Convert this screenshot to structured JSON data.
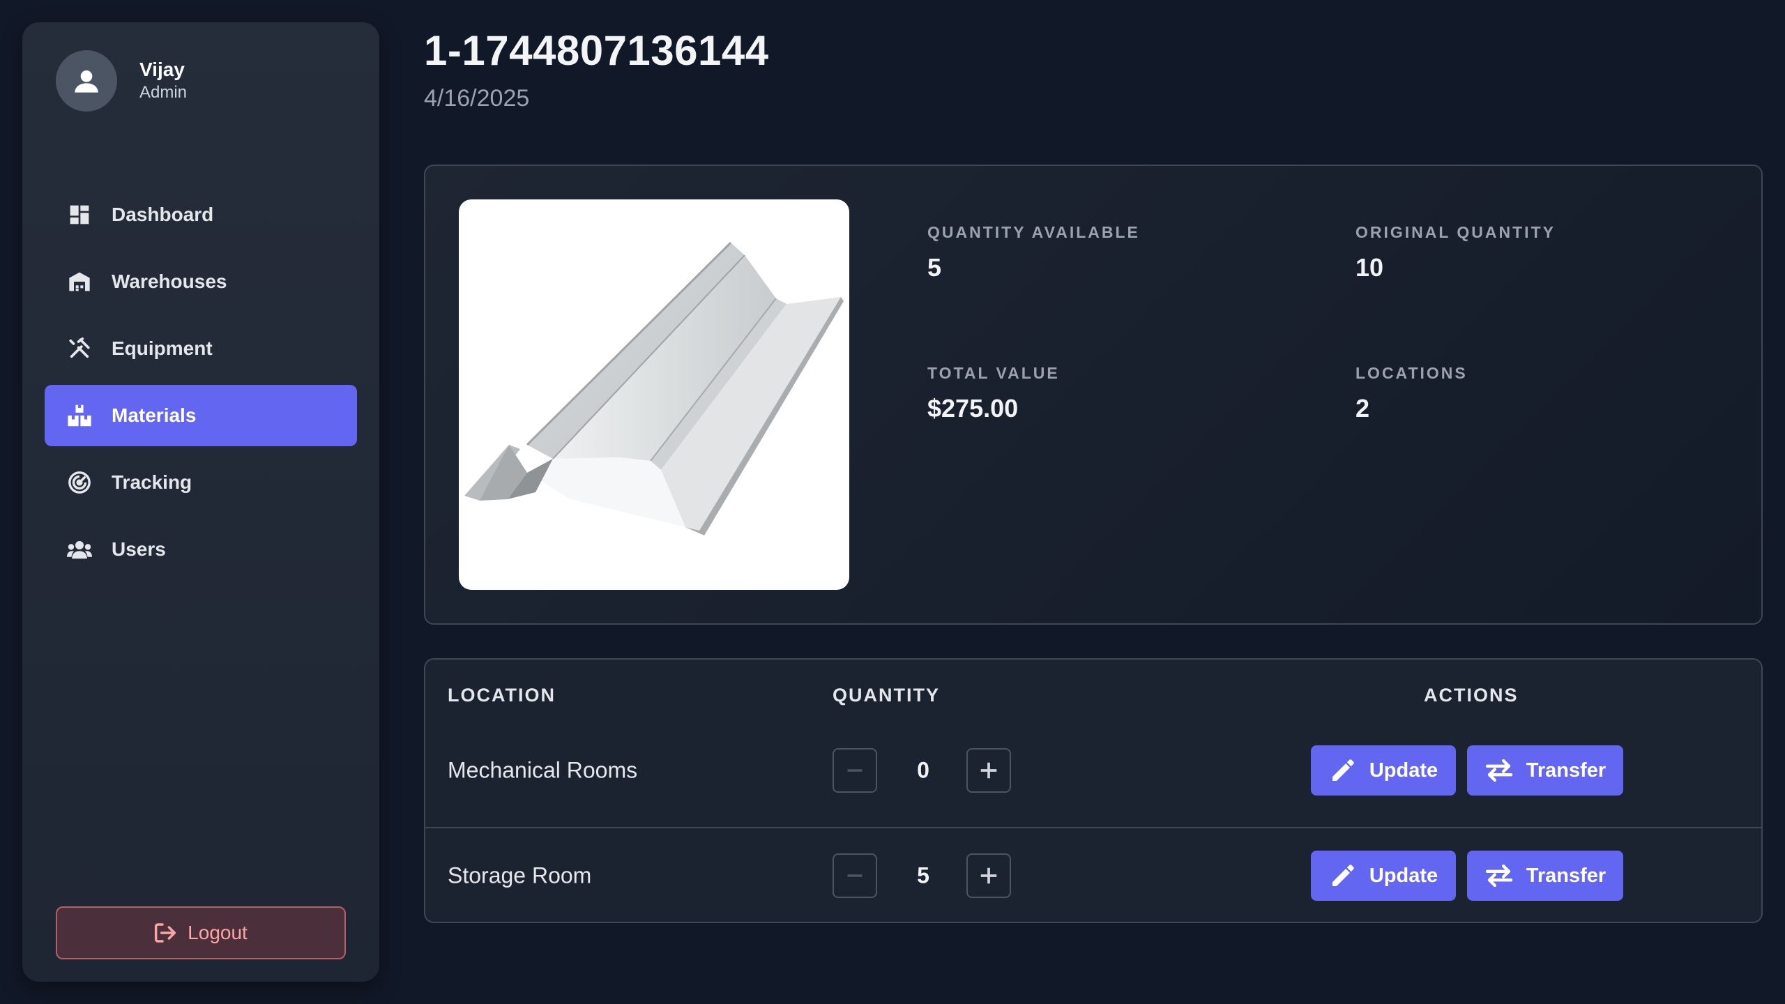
{
  "user": {
    "name": "Vijay",
    "role": "Admin"
  },
  "nav": {
    "items": [
      {
        "label": "Dashboard",
        "icon": "dashboard-icon"
      },
      {
        "label": "Warehouses",
        "icon": "warehouse-icon"
      },
      {
        "label": "Equipment",
        "icon": "tools-icon"
      },
      {
        "label": "Materials",
        "icon": "boxes-icon",
        "active": true
      },
      {
        "label": "Tracking",
        "icon": "tracking-icon"
      },
      {
        "label": "Users",
        "icon": "users-icon"
      }
    ],
    "logout_label": "Logout"
  },
  "material": {
    "id": "1-1744807136144",
    "date": "4/16/2025",
    "image": "metal-channel-icon"
  },
  "stats": {
    "quantity_available": {
      "label": "QUANTITY AVAILABLE",
      "value": "5"
    },
    "original_quantity": {
      "label": "ORIGINAL QUANTITY",
      "value": "10"
    },
    "total_value": {
      "label": "TOTAL VALUE",
      "value": "$275.00"
    },
    "locations": {
      "label": "LOCATIONS",
      "value": "2"
    }
  },
  "table": {
    "headers": {
      "location": "LOCATION",
      "quantity": "QUANTITY",
      "actions": "ACTIONS"
    },
    "rows": [
      {
        "location": "Mechanical Rooms",
        "quantity": "0",
        "update_label": "Update",
        "transfer_label": "Transfer"
      },
      {
        "location": "Storage Room",
        "quantity": "5",
        "update_label": "Update",
        "transfer_label": "Transfer"
      }
    ]
  },
  "colors": {
    "background": "#111827",
    "sidebar": "#252c3a",
    "accent": "#6366f1",
    "logout_border": "#b45f6a",
    "logout_text": "#fca5a5"
  }
}
